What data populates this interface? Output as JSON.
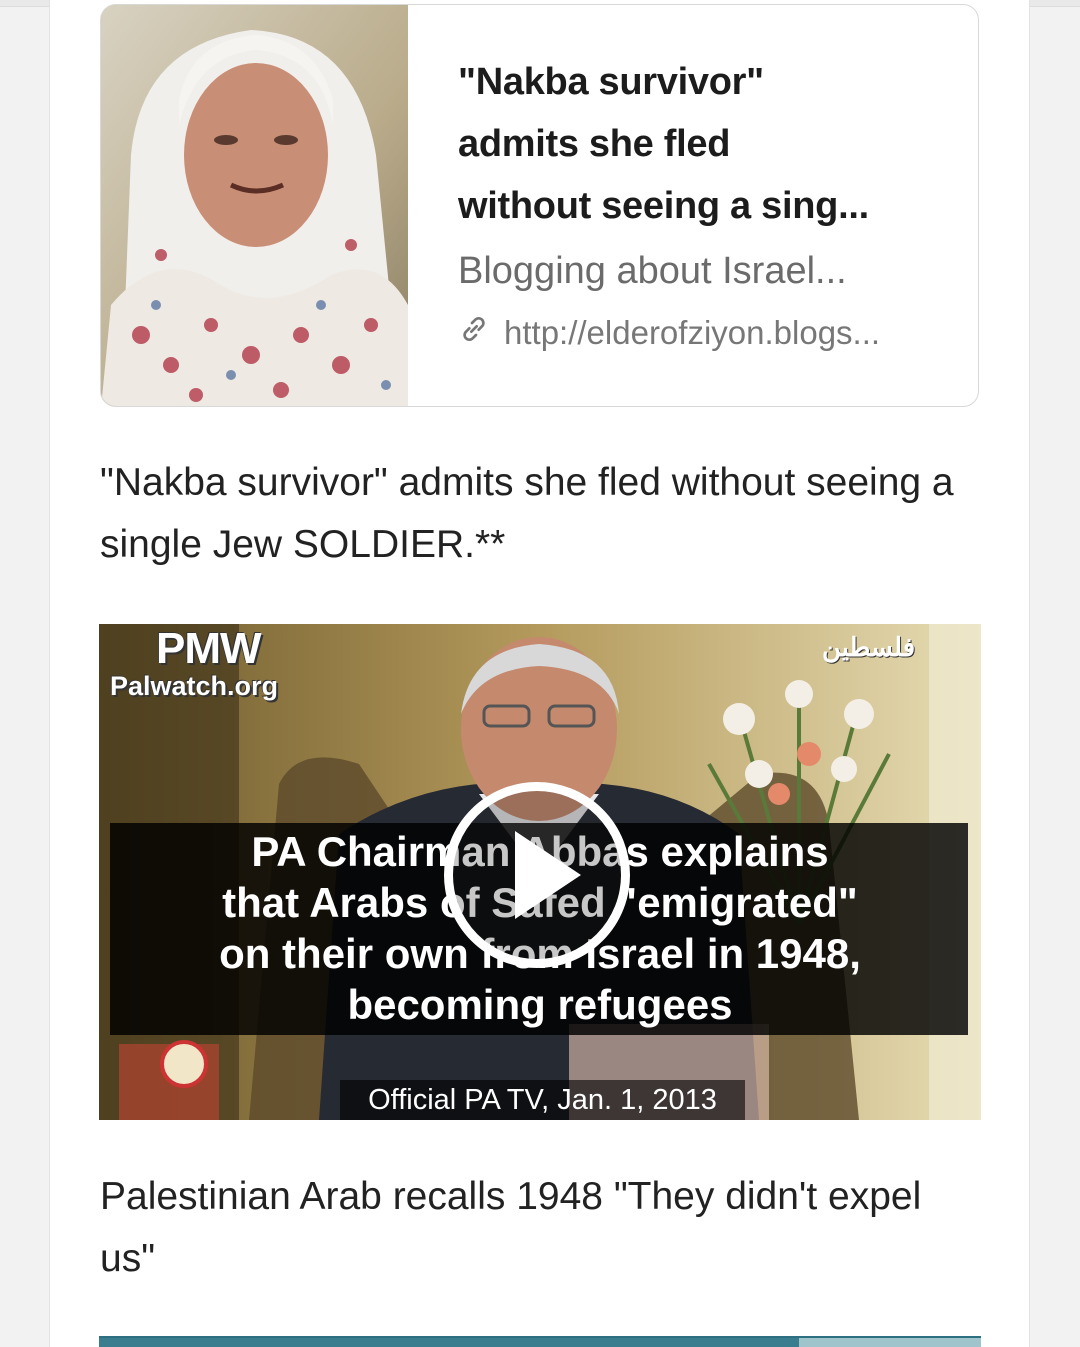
{
  "link_card": {
    "title_lines": [
      "\"Nakba survivor\"",
      "admits she fled",
      "without seeing a sing..."
    ],
    "site_name": "Blogging about Israel...",
    "url": "http://elderofziyon.blogs...",
    "thumbnail_icon": "portrait-photo",
    "link_icon": "link-icon"
  },
  "post": {
    "caption_1": "\"Nakba survivor\" admits she fled without seeing a single Jew SOLDIER.**",
    "caption_2": "Palestinian Arab recalls 1948 \"They didn't expel us\""
  },
  "video": {
    "watermark_brand": "PMW",
    "watermark_site": "Palwatch.org",
    "watermark_arabic": "فلسطين",
    "overlay_lines": [
      "PA Chairman Abbas explains",
      "that Arabs of Safed \"emigrated\"",
      "on their own from Israel in 1948,",
      "becoming refugees"
    ],
    "credit": "Official PA TV, Jan. 1, 2013",
    "play_icon": "play-icon"
  },
  "colors": {
    "card_border": "#d8d8d8",
    "title_text": "#1c1c1c",
    "secondary_text": "#6b6b6b",
    "body_text": "#222222"
  }
}
